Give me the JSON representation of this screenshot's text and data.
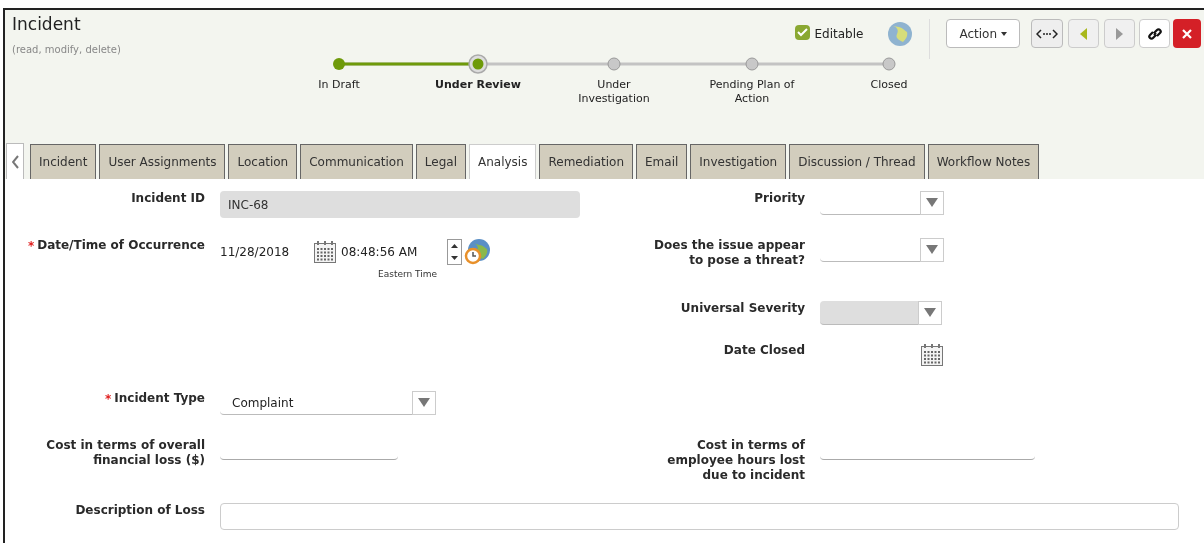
{
  "header": {
    "title": "Incident",
    "subtitle": "(read, modify, delete)",
    "editable": {
      "label": "Editable",
      "checked": true
    },
    "action_button": "Action"
  },
  "workflow": [
    {
      "label": "In Draft",
      "done": true,
      "selected": false
    },
    {
      "label": "Under Review",
      "done": true,
      "selected": true
    },
    {
      "label": "Under Investigation",
      "done": false,
      "selected": false
    },
    {
      "label": "Pending Plan of Action",
      "done": false,
      "selected": false
    },
    {
      "label": "Closed",
      "done": false,
      "selected": false
    }
  ],
  "tabs": [
    {
      "label": "Incident",
      "selected": false
    },
    {
      "label": "User Assignments",
      "selected": false
    },
    {
      "label": "Location",
      "selected": false
    },
    {
      "label": "Communication",
      "selected": false
    },
    {
      "label": "Legal",
      "selected": false
    },
    {
      "label": "Analysis",
      "selected": true
    },
    {
      "label": "Remediation",
      "selected": false
    },
    {
      "label": "Email",
      "selected": false
    },
    {
      "label": "Investigation",
      "selected": false
    },
    {
      "label": "Discussion / Thread",
      "selected": false
    },
    {
      "label": "Workflow Notes",
      "selected": false
    }
  ],
  "form": {
    "rows": [
      {
        "left": {
          "label": "Incident ID",
          "kind": "readonly",
          "value": "INC-68"
        },
        "right": {
          "label": "Priority",
          "kind": "select",
          "disabled": false
        }
      },
      {
        "left": {
          "label": "Date/Time of Occurrence",
          "kind": "datetime",
          "date": "11/28/2018",
          "time": "08:48:56 AM",
          "timezone": "Eastern Time",
          "required_mark": "*"
        },
        "right": {
          "label": "Does the issue appear to pose a threat?",
          "kind": "select",
          "disabled": false
        }
      },
      {
        "right": {
          "label": "Universal Severity",
          "kind": "select",
          "disabled": true
        }
      },
      {
        "right": {
          "label": "Date Closed",
          "kind": "date"
        }
      },
      {
        "left": {
          "label": "Incident Type",
          "kind": "select",
          "value": "Complaint",
          "disabled": false,
          "required_mark": "*"
        }
      },
      {
        "left": {
          "label": "Cost in terms of overall financial loss ($)",
          "kind": "text"
        },
        "right": {
          "label": "Cost in terms of employee hours lost due to incident",
          "kind": "text"
        }
      }
    ],
    "description": {
      "label": "Description of Loss",
      "kind": "textarea"
    }
  }
}
